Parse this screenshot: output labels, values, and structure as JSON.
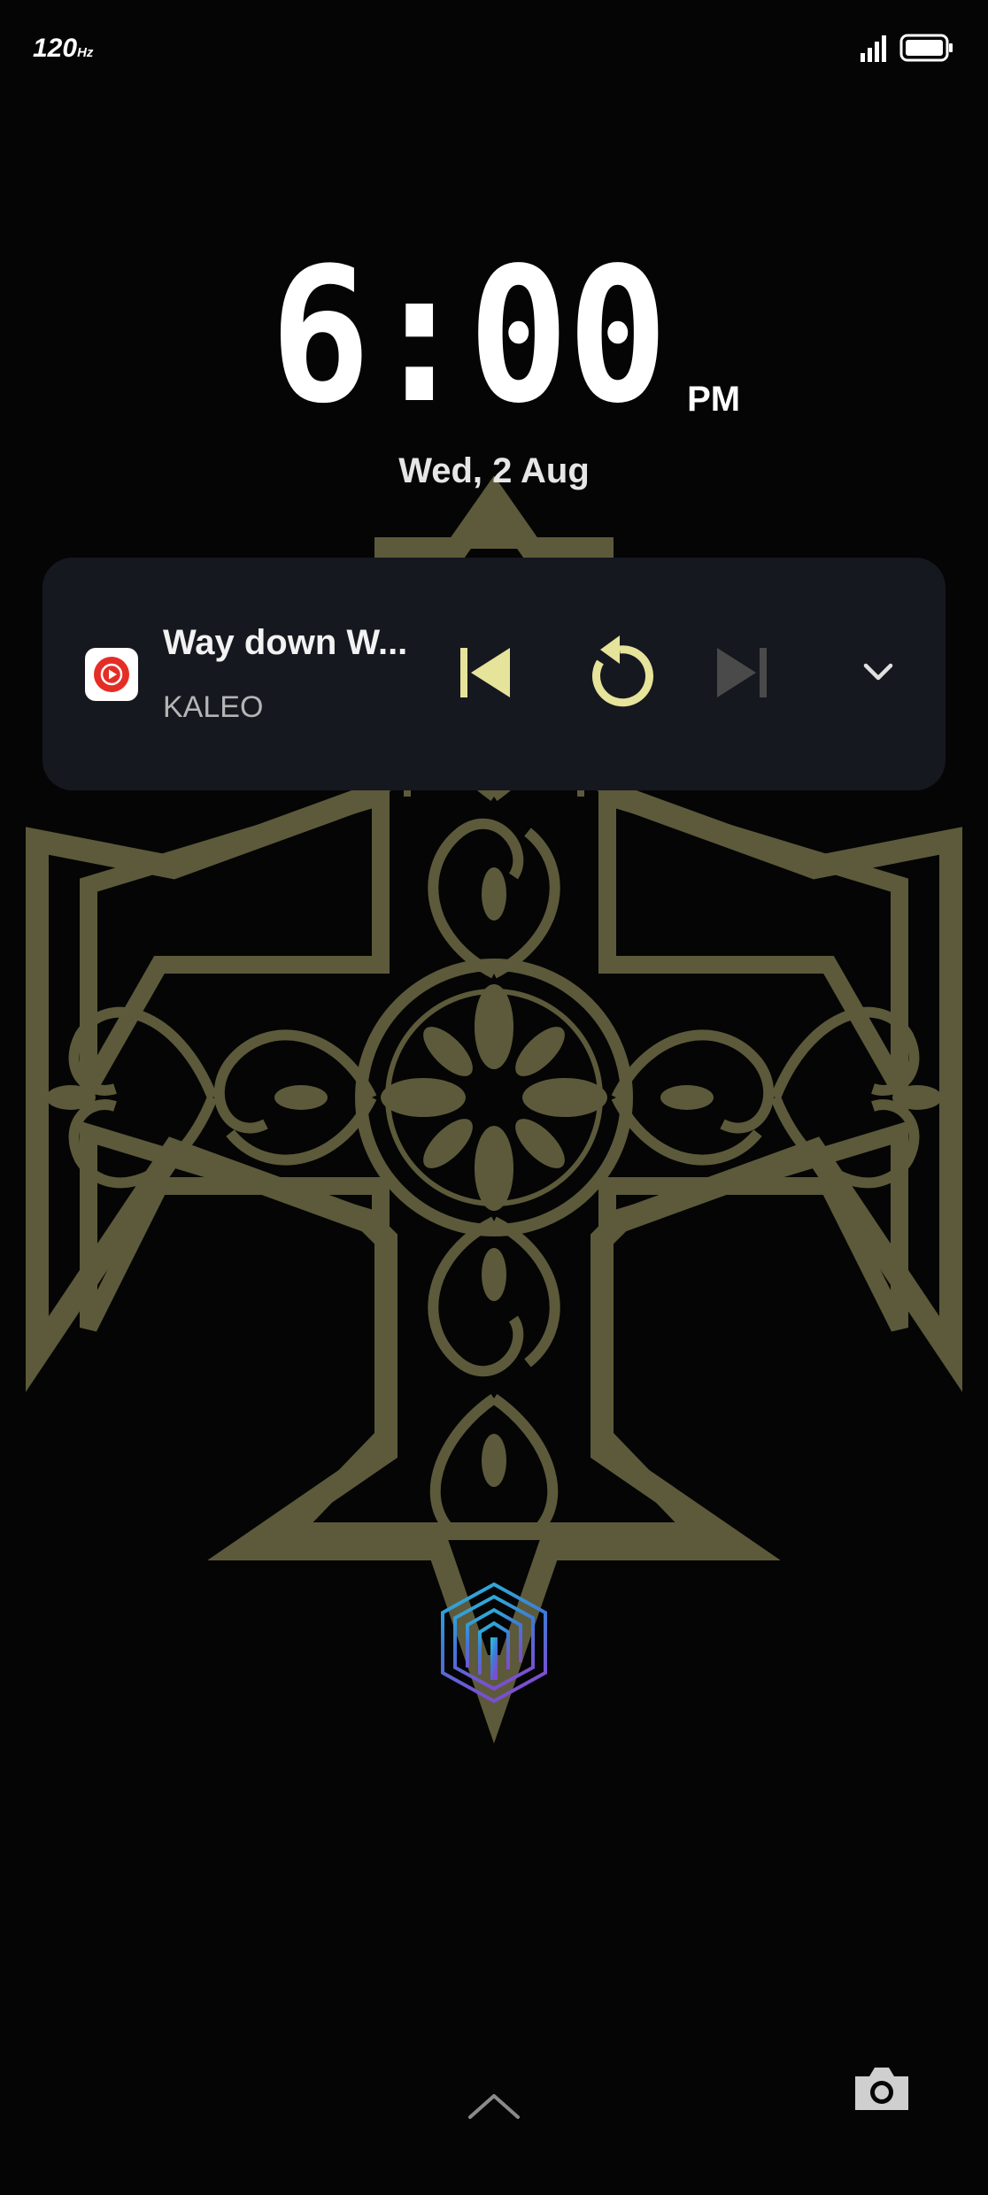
{
  "status_bar": {
    "refresh_rate": "120",
    "refresh_rate_unit": "Hz",
    "signal_icon": "cellular-signal-icon",
    "battery_icon": "battery-icon"
  },
  "lock_screen": {
    "time": "6:00",
    "ampm": "PM",
    "date": "Wed, 2 Aug"
  },
  "media_card": {
    "app_icon": "youtube-music-icon",
    "title": "Way down W...",
    "artist": "KALEO",
    "controls": [
      "previous-track-icon",
      "replay-icon",
      "next-track-icon",
      "chevron-down-icon"
    ],
    "accent_color": "#e6e39a",
    "disabled_color": "#4a4a4a"
  },
  "bottom": {
    "fingerprint_icon": "fingerprint-icon",
    "swipe_icon": "chevron-up-icon",
    "camera_icon": "camera-icon"
  },
  "colors": {
    "background": "#050505",
    "wallpaper_ornament": "#5c5a3a",
    "card_background": "#161820"
  }
}
